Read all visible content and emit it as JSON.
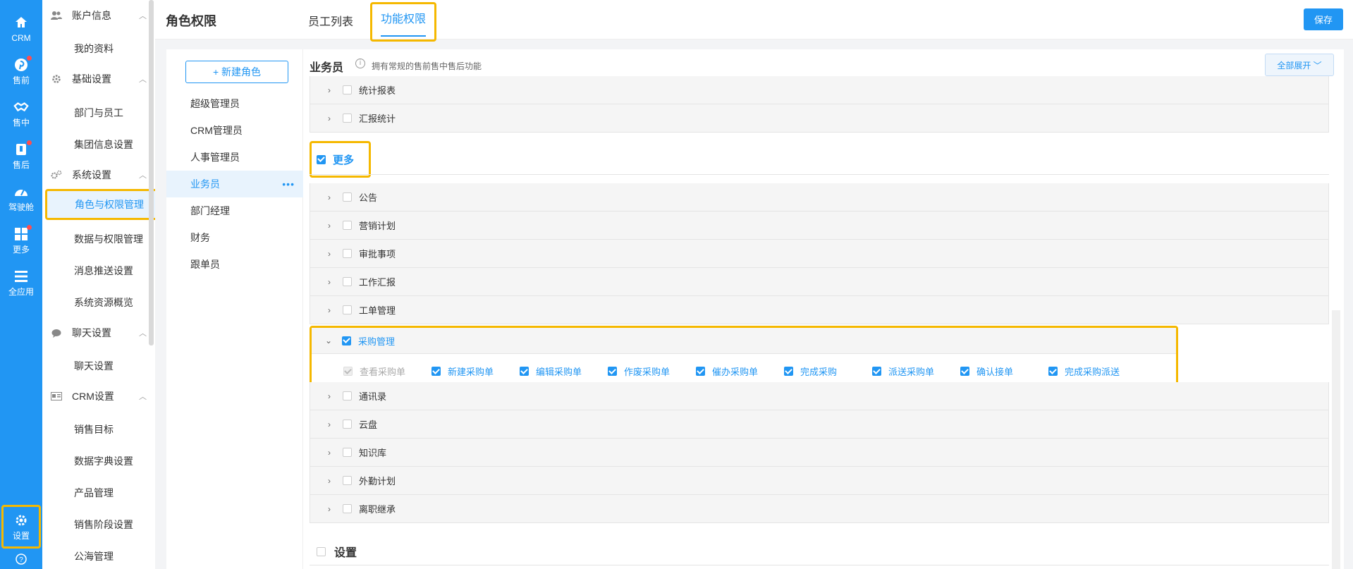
{
  "rail": {
    "items": [
      {
        "label": "CRM",
        "icon": "home-icon"
      },
      {
        "label": "售前",
        "icon": "pinterest-icon"
      },
      {
        "label": "售中",
        "icon": "handshake-icon"
      },
      {
        "label": "售后",
        "icon": "badge-icon"
      },
      {
        "label": "驾驶舱",
        "icon": "gauge-icon"
      },
      {
        "label": "更多",
        "icon": "grid-icon"
      },
      {
        "label": "全应用",
        "icon": "list-icon"
      }
    ],
    "settings_label": "设置"
  },
  "nav": {
    "groups": [
      {
        "label": "账户信息",
        "icon": "users-icon",
        "items": [
          "我的资料"
        ]
      },
      {
        "label": "基础设置",
        "icon": "gear-icon",
        "items": [
          "部门与员工",
          "集团信息设置"
        ]
      },
      {
        "label": "系统设置",
        "icon": "gears-icon",
        "items": [
          "角色与权限管理",
          "数据与权限管理",
          "消息推送设置",
          "系统资源概览"
        ]
      },
      {
        "label": "聊天设置",
        "icon": "chat-icon",
        "items": [
          "聊天设置"
        ]
      },
      {
        "label": "CRM设置",
        "icon": "card-icon",
        "items": [
          "销售目标",
          "数据字典设置",
          "产品管理",
          "销售阶段设置",
          "公海管理"
        ]
      }
    ]
  },
  "header": {
    "title": "角色权限",
    "tabs": [
      "员工列表",
      "功能权限"
    ],
    "save_label": "保存"
  },
  "roles": {
    "new_label": "+ 新建角色",
    "items": [
      "超级管理员",
      "CRM管理员",
      "人事管理员",
      "业务员",
      "部门经理",
      "财务",
      "跟单员"
    ],
    "more": "•••"
  },
  "perm": {
    "role_title": "业务员",
    "description": "拥有常规的售前售中售后功能",
    "expand_label": "全部展开 ﹀",
    "top_rows": [
      "统计报表",
      "汇报统计"
    ],
    "section_label": "更多",
    "rows_before": [
      "公告",
      "营销计划",
      "审批事项",
      "工作汇报",
      "工单管理"
    ],
    "open_row": {
      "label": "采购管理",
      "subs": [
        "查看采购单",
        "新建采购单",
        "编辑采购单",
        "作废采购单",
        "催办采购单",
        "完成采购",
        "派送采购单",
        "确认接单",
        "完成采购派送"
      ]
    },
    "rows_after": [
      "通讯录",
      "云盘",
      "知识库",
      "外勤计划",
      "离职继承"
    ],
    "settings_label": "设置"
  }
}
